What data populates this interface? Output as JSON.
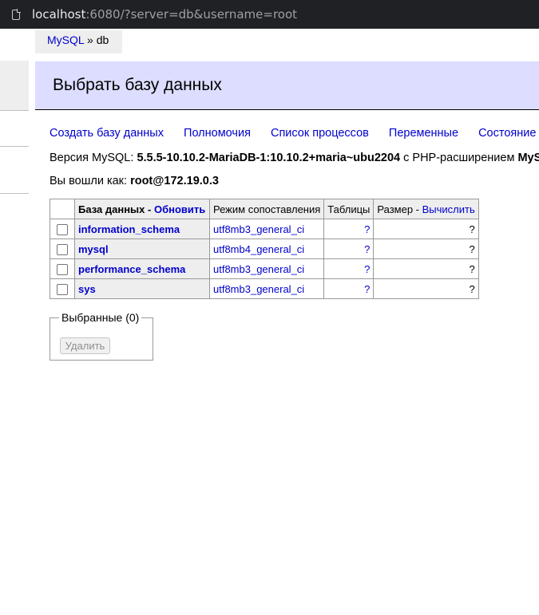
{
  "browser": {
    "url_host": "localhost",
    "url_rest": ":6080/?server=db&username=root",
    "icon": "page-icon"
  },
  "breadcrumb": {
    "server_link": "MySQL",
    "separator": " » ",
    "current": "db"
  },
  "header": {
    "title": "Выбрать базу данных"
  },
  "links": [
    "Создать базу данных",
    "Полномочия",
    "Список процессов",
    "Переменные",
    "Состояние"
  ],
  "version": {
    "prefix": "Версия MySQL: ",
    "value": "5.5.5-10.10.2-MariaDB-1:10.10.2+maria~ubu2204",
    "suffix": " с PHP-расширением ",
    "ext": "MyS"
  },
  "login": {
    "prefix": "Вы вошли как: ",
    "user": "root@172.19.0.3"
  },
  "table": {
    "headers": {
      "database": "База данных",
      "refresh_sep": " - ",
      "refresh": "Обновить",
      "collation": "Режим сопоставления",
      "tables": "Таблицы",
      "size": "Размер",
      "compute_sep": " - ",
      "compute": "Вычислить"
    },
    "rows": [
      {
        "name": "information_schema",
        "collation": "utf8mb3_general_ci",
        "tables": "?",
        "size": "?"
      },
      {
        "name": "mysql",
        "collation": "utf8mb4_general_ci",
        "tables": "?",
        "size": "?"
      },
      {
        "name": "performance_schema",
        "collation": "utf8mb3_general_ci",
        "tables": "?",
        "size": "?"
      },
      {
        "name": "sys",
        "collation": "utf8mb3_general_ci",
        "tables": "?",
        "size": "?"
      }
    ]
  },
  "selected": {
    "legend": "Выбранные (0)",
    "delete_button": "Удалить"
  }
}
